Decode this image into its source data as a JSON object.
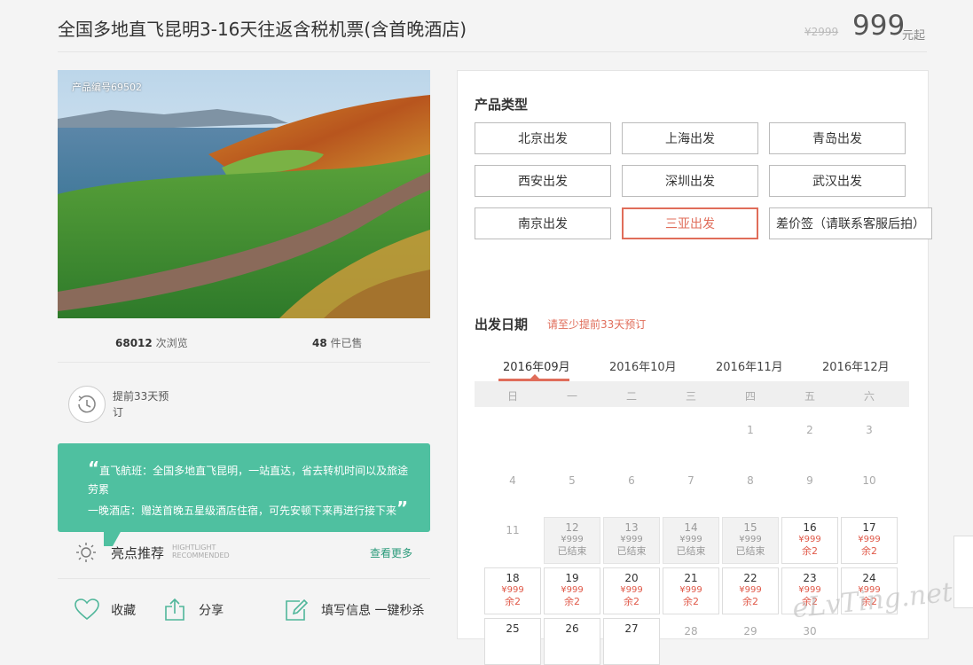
{
  "title": "全国多地直飞昆明3-16天往返含税机票(含首晚酒店)",
  "price": {
    "old": "¥2999",
    "current": "999",
    "unit": "元起"
  },
  "product_no": "产品编号69502",
  "stats": {
    "views_num": "68012",
    "views_label": "次浏览",
    "sold_num": "48",
    "sold_label": "件已售"
  },
  "advance_booking": "提前33天预订",
  "highlights": {
    "line1": "直飞航班：全国多地直飞昆明，一站直达，省去转机时间以及旅途劳累",
    "line2": "一晚酒店：赠送首晚五星级酒店住宿，可先安顿下来再进行接下来",
    "open_quote": "“",
    "close_quote": "”",
    "title": "亮点推荐",
    "sub1": "HIGHTLIGHT",
    "sub2": "RECOMMENDED",
    "more": "查看更多"
  },
  "actions": {
    "favorite": "收藏",
    "share": "分享",
    "fill": "填写信息 一键秒杀"
  },
  "product_type": {
    "title": "产品类型",
    "options": [
      "北京出发",
      "上海出发",
      "青岛出发",
      "西安出发",
      "深圳出发",
      "武汉出发",
      "南京出发",
      "三亚出发",
      "差价签（请联系客服后拍）"
    ],
    "selected_index": 7
  },
  "departure": {
    "title": "出发日期",
    "note": "请至少提前33天预订",
    "months": [
      "2016年09月",
      "2016年10月",
      "2016年11月",
      "2016年12月"
    ],
    "active_month": 0,
    "weekdays": [
      "日",
      "一",
      "二",
      "三",
      "四",
      "五",
      "六"
    ],
    "rows": [
      [
        {
          "d": ""
        },
        {
          "d": ""
        },
        {
          "d": ""
        },
        {
          "d": ""
        },
        {
          "d": "1",
          "t": "plain"
        },
        {
          "d": "2",
          "t": "plain"
        },
        {
          "d": "3",
          "t": "plain"
        }
      ],
      [
        {
          "d": "4",
          "t": "plain"
        },
        {
          "d": "5",
          "t": "plain"
        },
        {
          "d": "6",
          "t": "plain"
        },
        {
          "d": "7",
          "t": "plain"
        },
        {
          "d": "8",
          "t": "plain"
        },
        {
          "d": "9",
          "t": "plain"
        },
        {
          "d": "10",
          "t": "plain"
        }
      ],
      [
        {
          "d": "11",
          "t": "plain"
        },
        {
          "d": "12",
          "t": "ended",
          "p": "¥999",
          "s": "已结束"
        },
        {
          "d": "13",
          "t": "ended",
          "p": "¥999",
          "s": "已结束"
        },
        {
          "d": "14",
          "t": "ended",
          "p": "¥999",
          "s": "已结束"
        },
        {
          "d": "15",
          "t": "ended",
          "p": "¥999",
          "s": "已结束"
        },
        {
          "d": "16",
          "t": "avail",
          "p": "¥999",
          "s": "余2"
        },
        {
          "d": "17",
          "t": "avail",
          "p": "¥999",
          "s": "余2"
        }
      ],
      [
        {
          "d": "18",
          "t": "avail",
          "p": "¥999",
          "s": "余2"
        },
        {
          "d": "19",
          "t": "avail",
          "p": "¥999",
          "s": "余2"
        },
        {
          "d": "20",
          "t": "avail",
          "p": "¥999",
          "s": "余2"
        },
        {
          "d": "21",
          "t": "avail",
          "p": "¥999",
          "s": "余2"
        },
        {
          "d": "22",
          "t": "avail",
          "p": "¥999",
          "s": "余2"
        },
        {
          "d": "23",
          "t": "avail",
          "p": "¥999",
          "s": "余2"
        },
        {
          "d": "24",
          "t": "avail",
          "p": "¥999",
          "s": "余2"
        }
      ],
      [
        {
          "d": "25",
          "t": "avail"
        },
        {
          "d": "26",
          "t": "avail"
        },
        {
          "d": "27",
          "t": "avail"
        },
        {
          "d": "28",
          "t": "plain"
        },
        {
          "d": "29",
          "t": "plain"
        },
        {
          "d": "30",
          "t": "plain"
        },
        {
          "d": ""
        }
      ]
    ]
  },
  "watermark": "eLvTing.net",
  "icons": {
    "clock": "clock-icon",
    "sun": "sun-icon",
    "heart": "heart-icon",
    "share": "share-icon",
    "edit": "edit-icon"
  },
  "colors": {
    "accent_red": "#e06d5a",
    "green": "#4fc0a0"
  }
}
